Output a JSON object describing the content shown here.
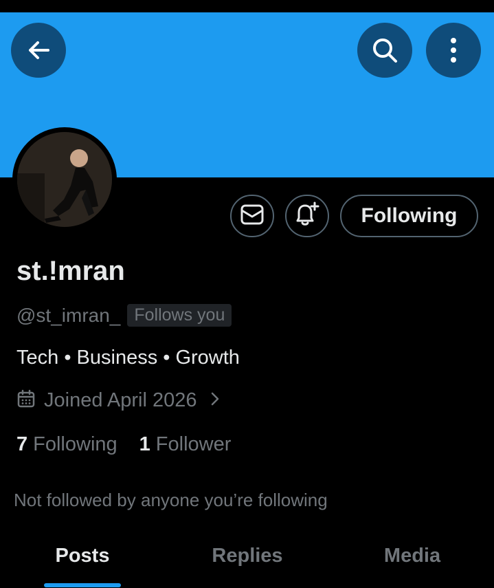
{
  "header": {
    "back_icon": "arrow-left-icon",
    "search_icon": "search-icon",
    "more_icon": "more-vertical-icon",
    "banner_color": "#1d9bf0"
  },
  "profile": {
    "display_name": "st.!mran",
    "handle": "@st_imran_",
    "follows_you_badge": "Follows you",
    "bio": "Tech • Business • Growth",
    "joined": "Joined April 2026",
    "following_count": "7",
    "following_label": "Following",
    "followers_count": "1",
    "followers_label": "Follower",
    "not_followed_text": "Not followed by anyone you’re following"
  },
  "actions": {
    "message_icon": "mail-icon",
    "notify_icon": "bell-plus-icon",
    "following_button": "Following"
  },
  "tabs": [
    {
      "label": "Posts",
      "active": true
    },
    {
      "label": "Replies",
      "active": false
    },
    {
      "label": "Media",
      "active": false
    }
  ],
  "colors": {
    "accent": "#1d9bf0",
    "muted_text": "#71767b",
    "primary_text": "#e7e9ea",
    "background": "#000000"
  }
}
